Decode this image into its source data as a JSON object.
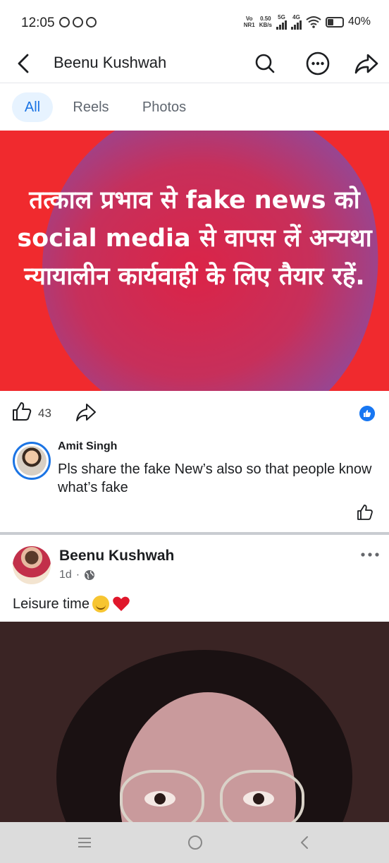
{
  "status_bar": {
    "time": "12:05",
    "net_line1": "Vo",
    "net_line2": "NR1",
    "speed_value": "0.50",
    "speed_unit": "KB/s",
    "net_5g": "5G",
    "net_4g": "4G",
    "battery": "40%"
  },
  "header": {
    "title": "Beenu Kushwah"
  },
  "tabs": [
    {
      "label": "All",
      "active": true
    },
    {
      "label": "Reels",
      "active": false
    },
    {
      "label": "Photos",
      "active": false
    }
  ],
  "post1": {
    "image_text": "तत्काल प्रभाव से fake news को social media से वापस लें अन्यथा न्यायालीन कार्यवाही के लिए तैयार रहें.",
    "like_count": "43",
    "colors": {
      "background": "#f02a2e",
      "blob": "#c23060",
      "accent": "#1877f2"
    }
  },
  "comment": {
    "author": "Amit Singh",
    "text": "Pls share the fake New’s also so that people know what’s fake"
  },
  "post2": {
    "author": "Beenu Kushwah",
    "time": "1d",
    "separator": "·",
    "caption": "Leisure time"
  },
  "icons": [
    "back-icon",
    "search-icon",
    "more-icon",
    "share-icon",
    "like-icon",
    "globe-icon",
    "smile-emoji",
    "heart-emoji",
    "menu-icon",
    "home-icon",
    "back-nav-icon"
  ]
}
